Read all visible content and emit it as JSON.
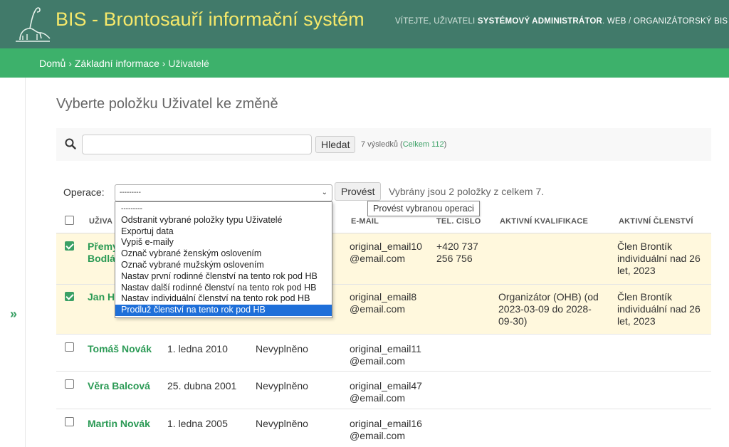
{
  "header": {
    "brand": "BIS - Brontosauří informační systém",
    "welcome": "VÍTEJTE, UŽIVATELI ",
    "user": "SYSTÉMOVÝ ADMINISTRÁTOR",
    "links_sep": ". ",
    "link_web": "WEB",
    "slash": " / ",
    "link_org": "ORGANIZÁTORSKÝ BIS"
  },
  "breadcrumbs": {
    "home": "Domů",
    "sep": " › ",
    "section": "Základní informace",
    "current": "Uživatelé"
  },
  "sidebar_toggle": "»",
  "page_title": "Vyberte položku Uživatel ke změně",
  "search": {
    "button": "Hledat",
    "results": "7 výsledků (",
    "total": "Celkem 112",
    "close": ")"
  },
  "actions": {
    "label": "Operace:",
    "selected_value": "---------",
    "run_button": "Provést",
    "tooltip": "Provést vybranou operaci",
    "selected_info": "Vybrány jsou 2 položky z celkem 7.",
    "options": [
      "---------",
      "Odstranit vybrané položky typu Uživatelé",
      "Exportuj data",
      "Vypiš e-maily",
      "Označ vybrané ženským oslovením",
      "Označ vybrané mužským oslovením",
      "Nastav první rodinné členství na tento rok pod HB",
      "Nastav další rodinné členství na tento rok pod HB",
      "Nastav individuální členství na tento rok pod HB",
      "Prodluž členství na tento rok pod HB"
    ],
    "highlighted_index": 9
  },
  "table": {
    "columns": {
      "user": "UŽIVA",
      "email": "E-MAIL",
      "phone": "TEL. CISLO",
      "qual": "AKTIVNÍ KVALIFIKACE",
      "member": "AKTIVNÍ ČLENSTVÍ"
    },
    "rows": [
      {
        "checked": true,
        "name_l1": "Přemy",
        "name_l2": "Bodlá",
        "birth": "",
        "city": "",
        "email_l1": "original_email10",
        "email_l2": "@email.com",
        "phone_l1": "+420 737",
        "phone_l2": "256 756",
        "qual_l1": "",
        "qual_l2": "",
        "qual_l3": "",
        "member_l1": "Člen Brontík",
        "member_l2": "individuální nad 26",
        "member_l3": "let, 2023"
      },
      {
        "checked": true,
        "name_l1": "Jan H",
        "name_l2": "",
        "birth": "",
        "city": "",
        "email_l1": "original_email8",
        "email_l2": "@email.com",
        "phone_l1": "",
        "phone_l2": "",
        "qual_l1": "Organizátor (OHB) (od",
        "qual_l2": "2023-03-09 do 2028-",
        "qual_l3": "09-30)",
        "member_l1": "Člen Brontík",
        "member_l2": "individuální nad 26",
        "member_l3": "let, 2023"
      },
      {
        "checked": false,
        "name_l1": "Tomáš Novák",
        "name_l2": "",
        "birth": "1. ledna 2010",
        "city": "Nevyplněno",
        "email_l1": "original_email11",
        "email_l2": "@email.com",
        "phone_l1": "",
        "phone_l2": "",
        "qual_l1": "",
        "qual_l2": "",
        "qual_l3": "",
        "member_l1": "",
        "member_l2": "",
        "member_l3": ""
      },
      {
        "checked": false,
        "name_l1": "Věra Balcová",
        "name_l2": "",
        "birth": "25. dubna 2001",
        "city": "Nevyplněno",
        "email_l1": "original_email47",
        "email_l2": "@email.com",
        "phone_l1": "",
        "phone_l2": "",
        "qual_l1": "",
        "qual_l2": "",
        "qual_l3": "",
        "member_l1": "",
        "member_l2": "",
        "member_l3": ""
      },
      {
        "checked": false,
        "name_l1": "Martin Novák",
        "name_l2": "",
        "birth": "1. ledna 2005",
        "city": "Nevyplněno",
        "email_l1": "original_email16",
        "email_l2": "@email.com",
        "phone_l1": "",
        "phone_l2": "",
        "qual_l1": "",
        "qual_l2": "",
        "qual_l3": "",
        "member_l1": "",
        "member_l2": "",
        "member_l3": ""
      }
    ]
  },
  "colors": {
    "header": "#417a6a",
    "breadcrumb": "#3db16b",
    "brand_text": "#f5e86a",
    "link_green": "#2b9a55",
    "selected_row": "#fff8dd",
    "highlight": "#1e6fd9"
  },
  "icons": {
    "logo": "brontosaurus-logo-icon",
    "search": "search-icon",
    "checkbox": "checkbox-icon",
    "chevron": "chevron-down-icon"
  }
}
